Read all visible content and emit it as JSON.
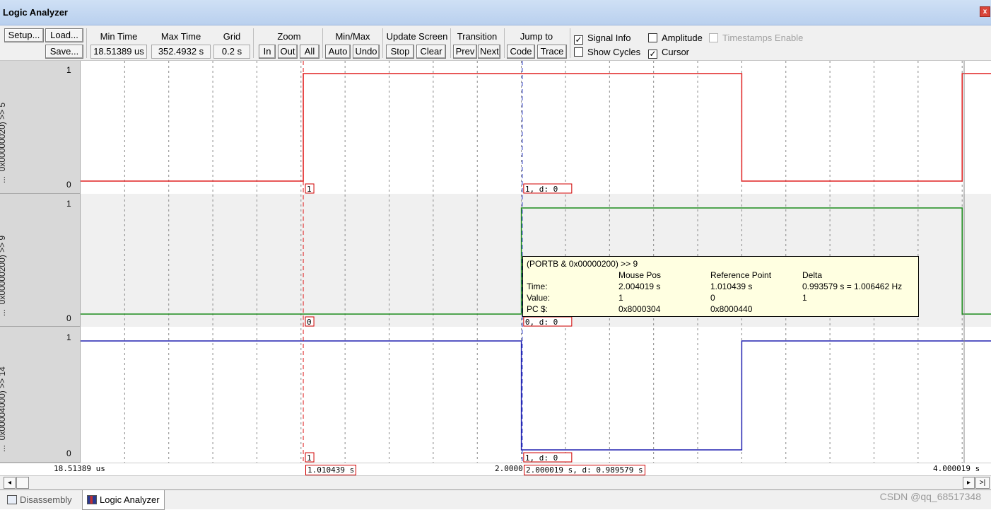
{
  "window": {
    "title": "Logic Analyzer",
    "close_glyph": "x"
  },
  "toolbar": {
    "setup": "Setup...",
    "load": "Load...",
    "save": "Save...",
    "min_time_label": "Min Time",
    "min_time_value": "18.51389 us",
    "max_time_label": "Max Time",
    "max_time_value": "352.4932 s",
    "grid_label": "Grid",
    "grid_value": "0.2 s",
    "zoom_label": "Zoom",
    "zoom_in": "In",
    "zoom_out": "Out",
    "zoom_all": "All",
    "minmax_label": "Min/Max",
    "minmax_auto": "Auto",
    "minmax_undo": "Undo",
    "update_label": "Update Screen",
    "update_stop": "Stop",
    "update_clear": "Clear",
    "transition_label": "Transition",
    "transition_prev": "Prev",
    "transition_next": "Next",
    "jump_label": "Jump to",
    "jump_code": "Code",
    "jump_trace": "Trace",
    "signal_info": "Signal Info",
    "signal_info_checked": true,
    "amplitude": "Amplitude",
    "amplitude_checked": false,
    "timestamps": "Timestamps Enable",
    "timestamps_checked": false,
    "show_cycles": "Show Cycles",
    "show_cycles_checked": false,
    "cursor": "Cursor",
    "cursor_checked": true
  },
  "lanes": [
    {
      "label": "... 0x00000020) >> 5",
      "lead": "...",
      "expr": "0x00000020) >> 5",
      "high_label": "1",
      "low_label": "0",
      "color": "#e02020",
      "tag_ref": "1",
      "tag_cur": "1,  d: 0"
    },
    {
      "label": "... 0x00000200) >> 9",
      "lead": "...",
      "expr": "0x00000200) >> 9",
      "high_label": "1",
      "low_label": "0",
      "color": "#1a8a1a",
      "tag_ref": "0",
      "tag_cur": "0,  d: 0"
    },
    {
      "label": "... 0x00004000) >> 14",
      "lead": "...",
      "expr": "0x00004000) >> 14",
      "high_label": "1",
      "low_label": "0",
      "color": "#2020b0",
      "tag_ref": "1",
      "tag_cur": "1,  d: 0"
    }
  ],
  "tooltip": {
    "title": "(PORTB & 0x00000200) >> 9",
    "col_mouse": "Mouse Pos",
    "col_ref": "Reference Point",
    "col_delta": "Delta",
    "row_time": "Time:",
    "time_mouse": "2.004019 s",
    "time_ref": "1.010439 s",
    "time_delta": "0.993579 s = 1.006462 Hz",
    "row_value": "Value:",
    "value_mouse": "1",
    "value_ref": "0",
    "value_delta": "1",
    "row_pc": "PC $:",
    "pc_mouse": "0x8000304",
    "pc_ref": "0x8000440"
  },
  "axis": {
    "start": "18.51389 us",
    "ref_cursor": "1.010439 s",
    "mid_partial": "2.0000",
    "cursor": "2.000019 s,   d: 0.989579 s",
    "end": "4.000019 s"
  },
  "scrollbar": {
    "left_glyph": "◂",
    "right_glyph": "▸",
    "end_glyph": ">|"
  },
  "tabs": [
    {
      "label": "Disassembly",
      "active": false,
      "icon": "disassembly-icon"
    },
    {
      "label": "Logic Analyzer",
      "active": true,
      "icon": "logic-analyzer-icon"
    }
  ],
  "watermark": "CSDN @qq_68517348",
  "chart_data": {
    "type": "line",
    "title": "",
    "xlabel": "",
    "ylabel": "",
    "x_unit": "s",
    "xlim": [
      0,
      4.000019
    ],
    "ylim": [
      0,
      1
    ],
    "grid_step": 0.2,
    "reference_cursor": 1.010439,
    "mouse_cursor": 2.004019,
    "series": [
      {
        "name": "0x00000020) >> 5",
        "steps": [
          [
            0,
            0
          ],
          [
            1.010439,
            1
          ],
          [
            3.0,
            0
          ],
          [
            4.0,
            1
          ]
        ]
      },
      {
        "name": "0x00000200) >> 9",
        "steps": [
          [
            0,
            0
          ],
          [
            2.0,
            1
          ],
          [
            4.0,
            0
          ]
        ]
      },
      {
        "name": "0x00004000) >> 14",
        "steps": [
          [
            0,
            1
          ],
          [
            2.0,
            0
          ],
          [
            3.0,
            1
          ]
        ]
      }
    ]
  }
}
